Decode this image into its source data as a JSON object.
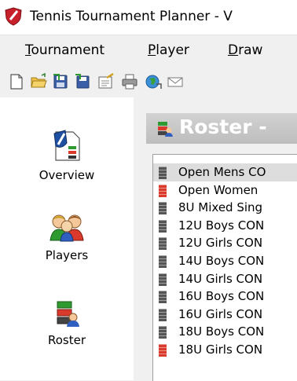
{
  "window": {
    "title": "Tennis Tournament Planner - V"
  },
  "menu": [
    {
      "accel": "T",
      "rest": "ournament"
    },
    {
      "accel": "P",
      "rest": "layer"
    },
    {
      "accel": "D",
      "rest": "raw"
    }
  ],
  "toolbar": {
    "icons": [
      "new-document-icon",
      "open-folder-icon",
      "save-icon",
      "save-as-icon",
      "properties-icon",
      "print-icon",
      "web-publish-icon",
      "email-icon"
    ]
  },
  "sidebar": {
    "items": [
      {
        "label": "Overview"
      },
      {
        "label": "Players"
      },
      {
        "label": "Roster"
      }
    ]
  },
  "main": {
    "header_title": "Roster -",
    "list": [
      {
        "text": "Open Mens CO",
        "color": "#555555",
        "selected": true
      },
      {
        "text": "Open Women",
        "color": "#d93a2c",
        "selected": false
      },
      {
        "text": "8U Mixed Sing",
        "color": "#555555",
        "selected": false
      },
      {
        "text": "12U Boys CON",
        "color": "#555555",
        "selected": false
      },
      {
        "text": "12U Girls CON",
        "color": "#555555",
        "selected": false
      },
      {
        "text": "14U Boys CON",
        "color": "#555555",
        "selected": false
      },
      {
        "text": "14U Girls CON",
        "color": "#555555",
        "selected": false
      },
      {
        "text": "16U Boys CON",
        "color": "#555555",
        "selected": false
      },
      {
        "text": "16U Girls CON",
        "color": "#555555",
        "selected": false
      },
      {
        "text": "18U Boys CON",
        "color": "#555555",
        "selected": false
      },
      {
        "text": "18U Girls CON",
        "color": "#d93a2c",
        "selected": false
      }
    ]
  }
}
